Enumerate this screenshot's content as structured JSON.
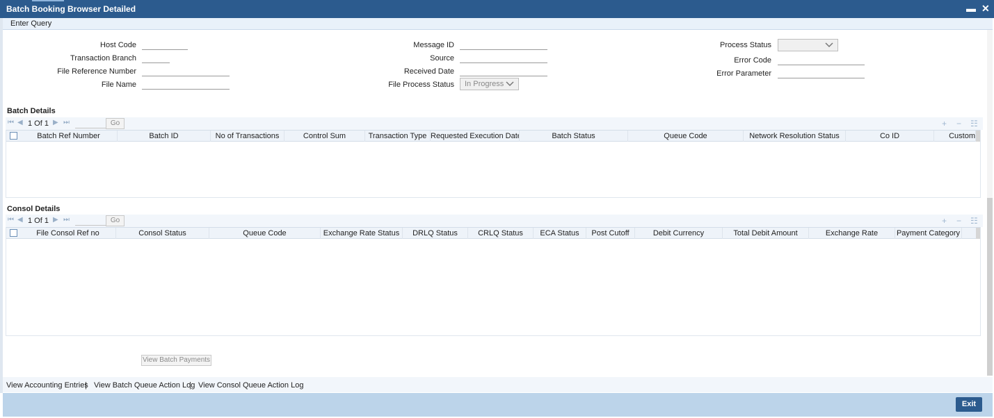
{
  "window": {
    "title": "Batch Booking Browser Detailed",
    "minimize_label": "▬",
    "close_label": "✕"
  },
  "menu": {
    "enter_query": "Enter Query"
  },
  "form": {
    "host_code": "Host Code",
    "transaction_branch": "Transaction Branch",
    "file_reference_number": "File Reference Number",
    "file_name": "File Name",
    "message_id": "Message ID",
    "source": "Source",
    "received_date": "Received Date",
    "file_process_status": "File Process Status",
    "file_process_status_value": "In Progress",
    "process_status": "Process Status",
    "process_status_value": "",
    "error_code": "Error Code",
    "error_parameter": "Error Parameter"
  },
  "batch": {
    "title": "Batch Details",
    "page_text": "1 Of 1",
    "go": "Go",
    "columns": [
      "Batch Ref Number",
      "Batch ID",
      "No of Transactions",
      "Control Sum",
      "Transaction Type",
      "Requested Execution Date",
      "Batch Status",
      "Queue Code",
      "Network Resolution Status",
      "Co ID",
      "Custom"
    ]
  },
  "consol": {
    "title": "Consol Details",
    "page_text": "1 Of 1",
    "go": "Go",
    "columns": [
      "File Consol Ref no",
      "Consol Status",
      "Queue Code",
      "Exchange Rate Status",
      "DRLQ Status",
      "CRLQ Status",
      "ECA Status",
      "Post Cutoff",
      "Debit Currency",
      "Total Debit Amount",
      "Exchange Rate",
      "Payment Category"
    ]
  },
  "buttons": {
    "view_batch_payments": "View Batch Payments",
    "exit": "Exit"
  },
  "links": {
    "view_accounting_entries": "View Accounting Entries",
    "view_batch_queue_log": "View Batch Queue Action Log",
    "view_consol_queue_log": "View Consol Queue Action Log",
    "separator": "|"
  },
  "colors": {
    "titlebar": "#2c5b8e",
    "footer": "#bcd4ea",
    "accent": "#2c5b8e"
  }
}
